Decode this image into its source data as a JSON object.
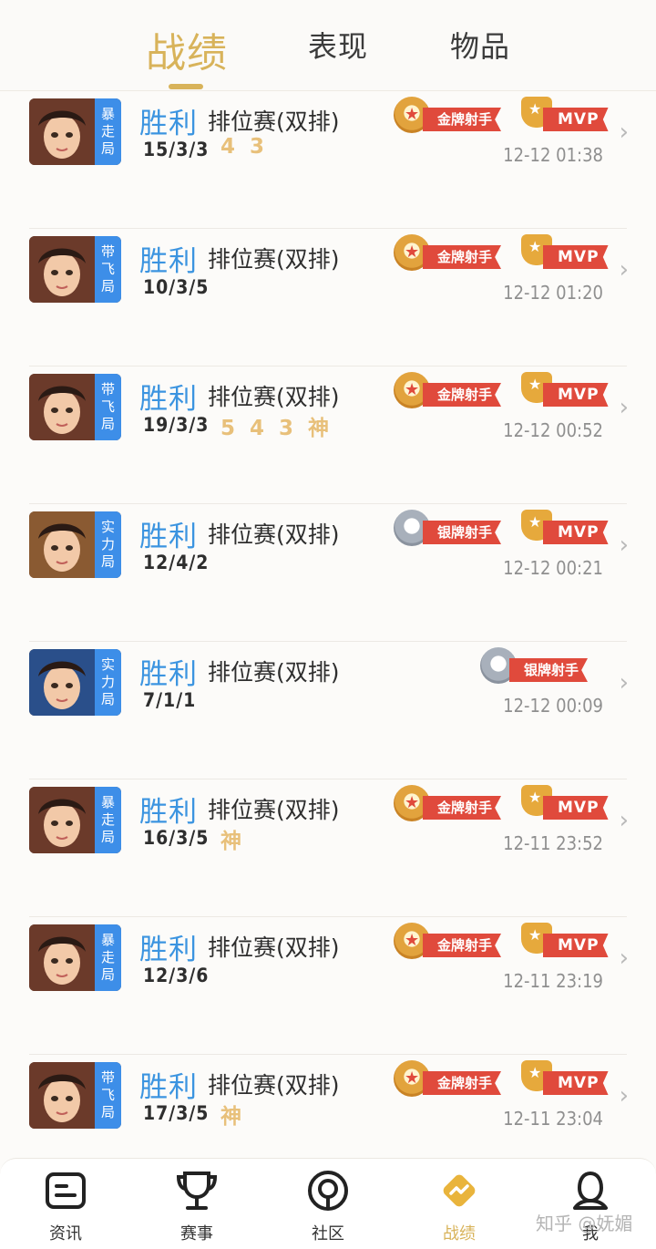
{
  "top_tabs": [
    {
      "label": "战绩",
      "active": true
    },
    {
      "label": "表现",
      "active": false
    },
    {
      "label": "物品",
      "active": false
    }
  ],
  "matches": [
    {
      "tag": "暴走局",
      "result": "胜利",
      "mode": "排位赛(双排)",
      "kda": "15/3/3",
      "kills": [
        "4",
        "3"
      ],
      "badge": "金牌射手",
      "badge_type": "gold",
      "mvp": true,
      "mvp_label": "MVP",
      "time": "12-12 01:38",
      "hero_color": "#6b3a2a"
    },
    {
      "tag": "带飞局",
      "result": "胜利",
      "mode": "排位赛(双排)",
      "kda": "10/3/5",
      "kills": [],
      "badge": "金牌射手",
      "badge_type": "gold",
      "mvp": true,
      "mvp_label": "MVP",
      "time": "12-12 01:20",
      "hero_color": "#6b3a2a"
    },
    {
      "tag": "带飞局",
      "result": "胜利",
      "mode": "排位赛(双排)",
      "kda": "19/3/3",
      "kills": [
        "5",
        "4",
        "3",
        "神"
      ],
      "badge": "金牌射手",
      "badge_type": "gold",
      "mvp": true,
      "mvp_label": "MVP",
      "time": "12-12 00:52",
      "hero_color": "#6b3a2a"
    },
    {
      "tag": "实力局",
      "result": "胜利",
      "mode": "排位赛(双排)",
      "kda": "12/4/2",
      "kills": [],
      "badge": "银牌射手",
      "badge_type": "silver",
      "mvp": true,
      "mvp_label": "MVP",
      "time": "12-12 00:21",
      "hero_color": "#8a5a32"
    },
    {
      "tag": "实力局",
      "result": "胜利",
      "mode": "排位赛(双排)",
      "kda": "7/1/1",
      "kills": [],
      "badge": "银牌射手",
      "badge_type": "silver",
      "mvp": false,
      "mvp_label": "",
      "time": "12-12 00:09",
      "hero_color": "#2a4f8a"
    },
    {
      "tag": "暴走局",
      "result": "胜利",
      "mode": "排位赛(双排)",
      "kda": "16/3/5",
      "kills": [
        "神"
      ],
      "badge": "金牌射手",
      "badge_type": "gold",
      "mvp": true,
      "mvp_label": "MVP",
      "time": "12-11 23:52",
      "hero_color": "#6b3a2a"
    },
    {
      "tag": "暴走局",
      "result": "胜利",
      "mode": "排位赛(双排)",
      "kda": "12/3/6",
      "kills": [],
      "badge": "金牌射手",
      "badge_type": "gold",
      "mvp": true,
      "mvp_label": "MVP",
      "time": "12-11 23:19",
      "hero_color": "#6b3a2a"
    },
    {
      "tag": "带飞局",
      "result": "胜利",
      "mode": "排位赛(双排)",
      "kda": "17/3/5",
      "kills": [
        "神"
      ],
      "badge": "金牌射手",
      "badge_type": "gold",
      "mvp": true,
      "mvp_label": "MVP",
      "time": "12-11 23:04",
      "hero_color": "#6b3a2a"
    }
  ],
  "bottom_nav": [
    {
      "label": "资讯",
      "icon": "news-icon",
      "active": false
    },
    {
      "label": "赛事",
      "icon": "trophy-icon",
      "active": false
    },
    {
      "label": "社区",
      "icon": "community-icon",
      "active": false
    },
    {
      "label": "战绩",
      "icon": "record-icon",
      "active": true
    },
    {
      "label": "我",
      "icon": "profile-icon",
      "active": false
    }
  ],
  "watermark": "知乎 @妩媚",
  "colors": {
    "accent": "#d8b35a",
    "win": "#3b94e0",
    "tag_bg": "#3d8ee8",
    "ribbon": "#e04a3c"
  }
}
